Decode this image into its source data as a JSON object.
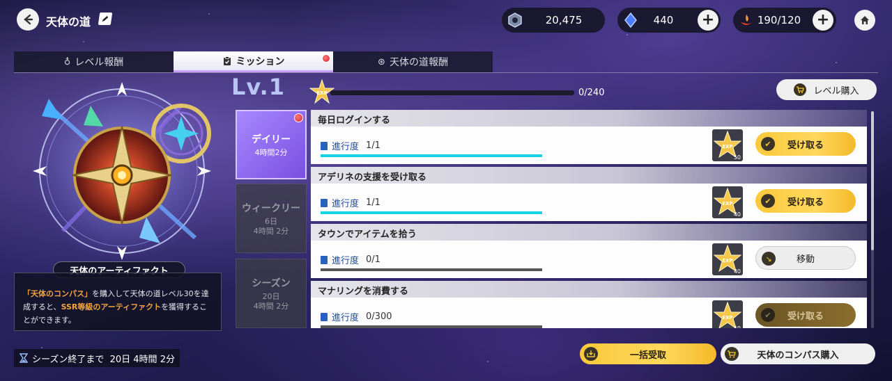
{
  "header": {
    "title": "天体の道",
    "currencies": [
      {
        "name": "gem-currency",
        "value": "20,475"
      },
      {
        "name": "crystal-currency",
        "value": "440"
      },
      {
        "name": "stamina-currency",
        "value": "190/120"
      }
    ]
  },
  "tabs": [
    {
      "label": "レベル報酬",
      "icon": "medal-icon",
      "active": false
    },
    {
      "label": "ミッション",
      "icon": "clipboard-icon",
      "active": true
    },
    {
      "label": "天体の道報酬",
      "icon": "compass-icon",
      "active": false
    }
  ],
  "artifact": {
    "name": "天体のアーティファクト",
    "desc_parts": [
      {
        "text": "「天体のコンパス」",
        "highlight": true
      },
      {
        "text": "を購入して天体の道レベル30を達成すると、",
        "highlight": false
      },
      {
        "text": "SSR等級のアーティファクト",
        "highlight": true
      },
      {
        "text": "を獲得することができます。",
        "highlight": false
      }
    ]
  },
  "level": {
    "label": "Lv.1",
    "exp_icon_text": "EXP",
    "progress_text": "0/240",
    "progress": 0,
    "buy_label": "レベル購入"
  },
  "categories": [
    {
      "name": "デイリー",
      "time": "4時間2分",
      "active": true,
      "badge": true
    },
    {
      "name": "ウィークリー",
      "time": "6日\n4時間 2分",
      "active": false,
      "badge": false
    },
    {
      "name": "シーズン",
      "time": "20日\n4時間 2分",
      "active": false,
      "badge": false
    }
  ],
  "missions": [
    {
      "title": "毎日ログインする",
      "progress_label": "進行度",
      "progress_value": "1/1",
      "fill": 1.0,
      "reward": "50",
      "button": "受け取る",
      "state": "claimable"
    },
    {
      "title": "アデリネの支援を受け取る",
      "progress_label": "進行度",
      "progress_value": "1/1",
      "fill": 1.0,
      "reward": "40",
      "button": "受け取る",
      "state": "claimable"
    },
    {
      "title": "タウンでアイテムを拾う",
      "progress_label": "進行度",
      "progress_value": "0/1",
      "fill": 0,
      "reward": "40",
      "button": "移動",
      "state": "move"
    },
    {
      "title": "マナリングを消費する",
      "progress_label": "進行度",
      "progress_value": "0/300",
      "fill": 0,
      "reward": "50",
      "button": "受け取る",
      "state": "disabled"
    }
  ],
  "footer": {
    "season_end": "シーズン終了まで  20日 4時間 2分",
    "claim_all": "一括受取",
    "compass_buy": "天体のコンパス購入"
  },
  "colors": {
    "accent_gold": "#f8c93a",
    "progress_cyan": "#14d4e6",
    "highlight_orange": "#f4a63c",
    "active_purple": "#a789ff"
  }
}
